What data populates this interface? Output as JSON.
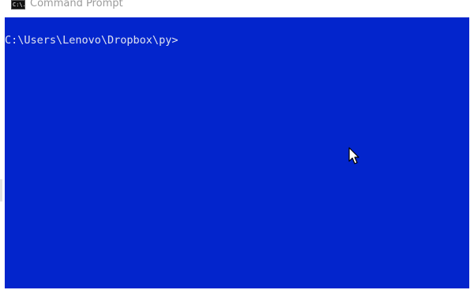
{
  "window": {
    "title": "Command Prompt",
    "icon": "cmd-app-icon",
    "icon_text": "C:\\."
  },
  "console": {
    "prompt": "C:\\Users\\Lenovo\\Dropbox\\py>",
    "background_color": "#0325cc",
    "text_color": "#dfe3f0"
  },
  "cursor": {
    "icon": "mouse-pointer-icon"
  }
}
